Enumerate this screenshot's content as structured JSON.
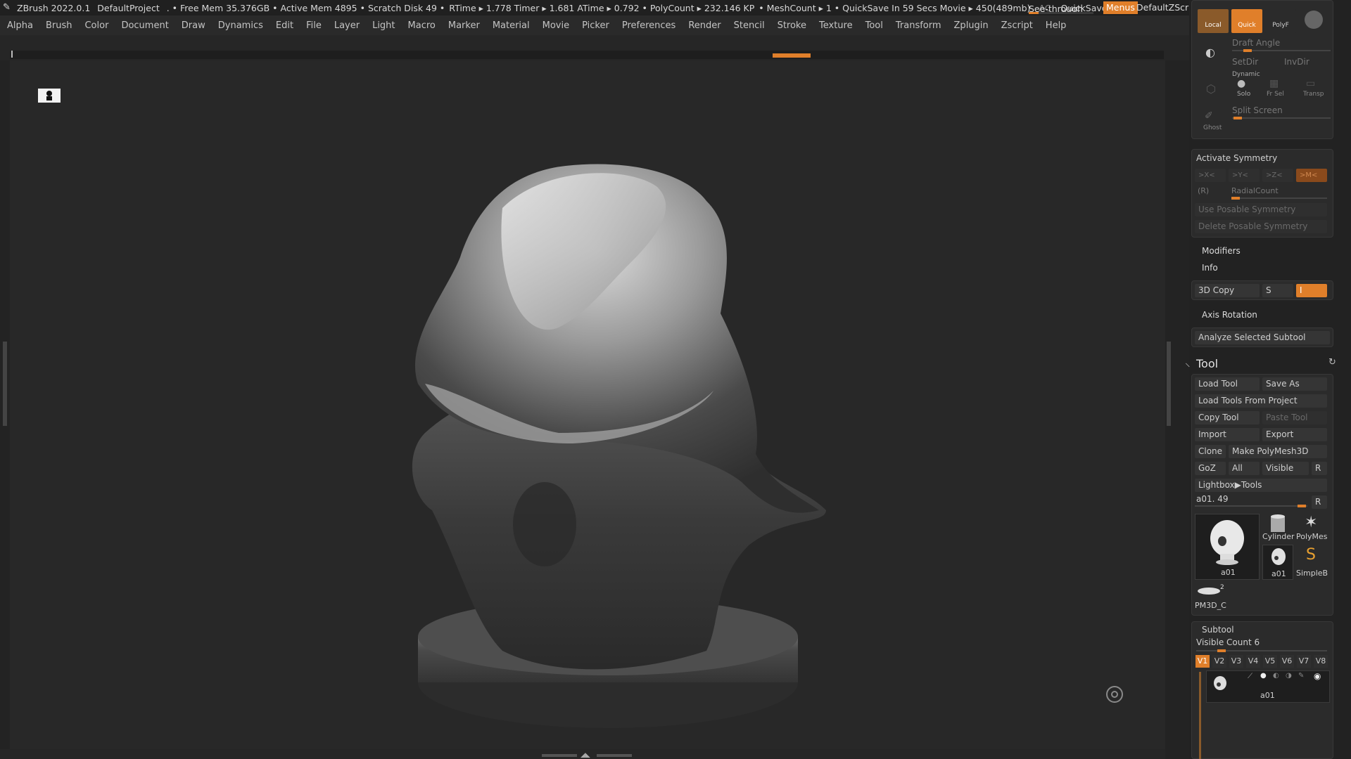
{
  "app": {
    "title": "ZBrush 2022.0.1",
    "project": "DefaultProject",
    "status_items": [
      ". • Free Mem 35.376GB",
      "• Active Mem 4895",
      "• Scratch Disk 49 •",
      "RTime ▸ 1.778 Timer ▸ 1.681 ATime ▸ 0.792",
      "• PolyCount ▸ 232.146 KP",
      "• MeshCount ▸ 1",
      "• QuickSave In 59 Secs Movie ▸ 450(489mb)"
    ],
    "ac_label": "AC",
    "quicksave_label": "QuickSave",
    "seethrough_label": "See-through",
    "seethrough_value": "0",
    "menus_label": "Menus",
    "script_label": "DefaultZScript"
  },
  "menubar": [
    "Alpha",
    "Brush",
    "Color",
    "Document",
    "Draw",
    "Dynamics",
    "Edit",
    "File",
    "Layer",
    "Light",
    "Macro",
    "Marker",
    "Material",
    "Movie",
    "Picker",
    "Preferences",
    "Render",
    "Stencil",
    "Stroke",
    "Texture",
    "Tool",
    "Transform",
    "Zplugin",
    "Zscript",
    "Help"
  ],
  "icons": {
    "zbrush_logo": "zbrush-logo-icon",
    "bust": "bust-icon",
    "target": "target-icon",
    "tool": "tool-brush-icon",
    "refresh": "refresh-icon"
  },
  "colors": {
    "accent": "#e07f2a",
    "panel": "#2b2b2b",
    "background": "#262626"
  },
  "top_panel": {
    "local": "Local",
    "quick": "Quick",
    "polyf": "PolyF",
    "draft_angle": "Draft Angle",
    "setdir": "SetDir",
    "invdir": "InvDir",
    "dynamic": "Dynamic",
    "solo": "Solo",
    "frsel": "Fr Sel",
    "transp": "Transp",
    "ghost": "Ghost",
    "split_screen": "Split Screen"
  },
  "symmetry": {
    "activate": "Activate Symmetry",
    "x": ">X<",
    "y": ">Y<",
    "z": ">Z<",
    "m": ">M<",
    "r": "(R)",
    "radial": "RadialCount",
    "use_posable": "Use Posable Symmetry",
    "delete_posable": "Delete Posable Symmetry"
  },
  "sections": {
    "modifiers": "Modifiers",
    "info": "Info",
    "copy3d": "3D Copy",
    "s": "S",
    "i": "I",
    "axis_rotation": "Axis Rotation",
    "analyze": "Analyze Selected Subtool"
  },
  "tool": {
    "title": "Tool",
    "load_tool": "Load Tool",
    "save_as": "Save As",
    "load_from_project": "Load Tools From Project",
    "copy_tool": "Copy Tool",
    "paste_tool": "Paste Tool",
    "import": "Import",
    "export": "Export",
    "clone": "Clone",
    "make_polymesh": "Make PolyMesh3D",
    "goz": "GoZ",
    "all": "All",
    "visible": "Visible",
    "r": "R",
    "lightbox": "Lightbox▶Tools",
    "current_tool": "a01. 49",
    "thumbs": [
      {
        "label": "a01"
      },
      {
        "label": "Cylinder"
      },
      {
        "label": "PolyMes"
      },
      {
        "label": "a01"
      },
      {
        "label": "SimpleB"
      },
      {
        "label": "PM3D_C"
      }
    ],
    "pm3d_count": "2"
  },
  "subtool": {
    "title": "Subtool",
    "visible_count": "Visible Count 6",
    "tabs": [
      "V1",
      "V2",
      "V3",
      "V4",
      "V5",
      "V6",
      "V7",
      "V8"
    ],
    "active_tab": "V1",
    "item_name": "a01"
  }
}
